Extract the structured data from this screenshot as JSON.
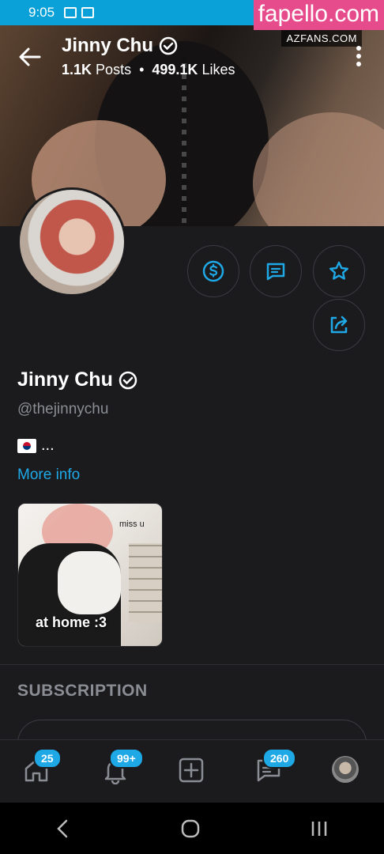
{
  "status_bar": {
    "time": "9:05"
  },
  "watermark": {
    "main": "fapello.com",
    "sub": "AZFANS.COM"
  },
  "header": {
    "name": "Jinny Chu",
    "posts_count": "1.1K",
    "posts_label": "Posts",
    "separator": "•",
    "likes_count": "499.1K",
    "likes_label": "Likes"
  },
  "profile": {
    "name": "Jinny Chu",
    "handle": "@thejinnychu",
    "bio": "...",
    "more_info": "More info"
  },
  "actions": [
    "tip-button",
    "message-button",
    "favorite-button",
    "share-button"
  ],
  "highlight": {
    "caption": "at home :3",
    "overlay": "miss u"
  },
  "subscription": {
    "title": "SUBSCRIPTION"
  },
  "nav": {
    "home_badge": "25",
    "notifications_badge": "99+",
    "messages_badge": "260"
  },
  "colors": {
    "accent": "#1fa8e6",
    "background": "#1b1b1e",
    "watermark": "#e64c8c"
  }
}
